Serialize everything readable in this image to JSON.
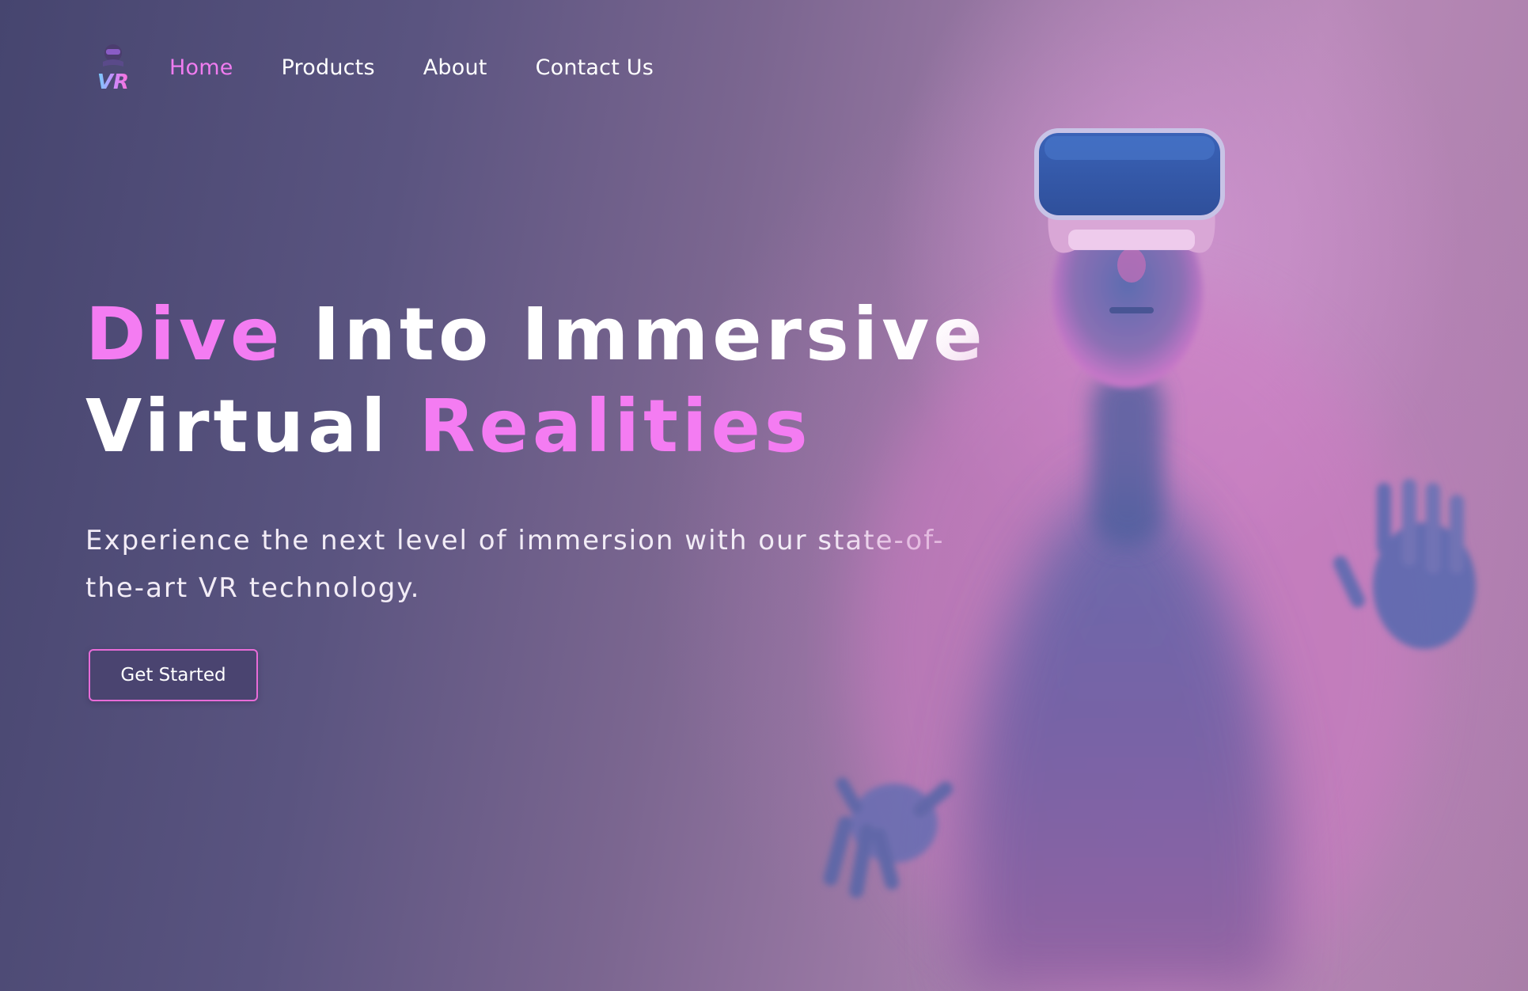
{
  "logo": {
    "text": "VR",
    "icon": "vr-headset-logo-icon"
  },
  "nav": {
    "items": [
      {
        "label": "Home",
        "active": true
      },
      {
        "label": "Products",
        "active": false
      },
      {
        "label": "About",
        "active": false
      },
      {
        "label": "Contact Us",
        "active": false
      }
    ]
  },
  "hero": {
    "title_line1_accent": "Dive",
    "title_line1_rest": " Into Immersive",
    "title_line2_rest": "Virtual ",
    "title_line2_accent": "Realities",
    "subtitle": "Experience the next level of immersion with our state-of-the-art VR technology.",
    "cta_label": "Get Started"
  },
  "image": {
    "subject": "person-with-vr-headset-icon"
  },
  "colors": {
    "accent": "#f47cf2",
    "background_start": "#46456f",
    "background_end": "#b889b8",
    "button_bg": "#4a4470",
    "button_border": "#e86bd8"
  }
}
